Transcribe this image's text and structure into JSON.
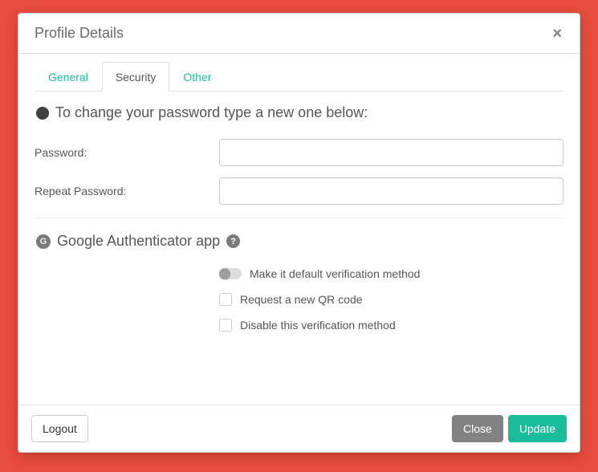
{
  "modal_title": "Profile Details",
  "tabs": {
    "general": "General",
    "security": "Security",
    "other": "Other"
  },
  "password_section": {
    "heading": "To change your password type a new one below:",
    "password_label": "Password:",
    "repeat_password_label": "Repeat Password:",
    "password_value": "",
    "repeat_password_value": ""
  },
  "authenticator_section": {
    "heading": "Google Authenticator app",
    "options": {
      "default": "Make it default verification method",
      "new_qr": "Request a new QR code",
      "disable": "Disable this verification method"
    }
  },
  "footer": {
    "logout": "Logout",
    "close": "Close",
    "update": "Update"
  }
}
